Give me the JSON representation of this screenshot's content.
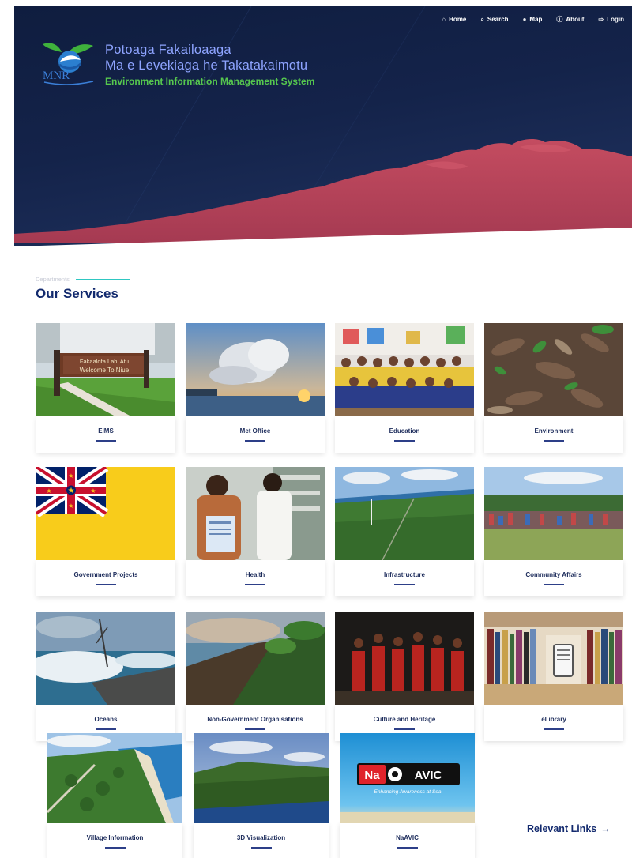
{
  "nav": {
    "items": [
      {
        "icon": "home-icon",
        "glyph": "⌂",
        "label": "Home",
        "active": true
      },
      {
        "icon": "search-icon",
        "glyph": "⌕",
        "label": "Search"
      },
      {
        "icon": "map-icon",
        "glyph": "●",
        "label": "Map"
      },
      {
        "icon": "info-icon",
        "glyph": "ⓘ",
        "label": "About"
      },
      {
        "icon": "login-icon",
        "glyph": "⇨",
        "label": "Login"
      }
    ]
  },
  "brand": {
    "logo_text": "MNR",
    "line1": "Potoaga Fakailoaaga",
    "line2": "Ma e Levekiaga he Takatakaimotu",
    "line3": "Environment Information Management System"
  },
  "services": {
    "eyebrow": "Departments",
    "title": "Our Services",
    "cards": [
      {
        "label": "EIMS",
        "sign1": "Fakaalofa Lahi Atu",
        "sign2": "Welcome To Niue"
      },
      {
        "label": "Met Office"
      },
      {
        "label": "Education"
      },
      {
        "label": "Environment"
      },
      {
        "label": "Government Projects"
      },
      {
        "label": "Health"
      },
      {
        "label": "Infrastructure"
      },
      {
        "label": "Community Affairs"
      },
      {
        "label": "Oceans"
      },
      {
        "label": "Non-Government Organisations"
      },
      {
        "label": "Culture and Heritage"
      },
      {
        "label": "eLibrary"
      },
      {
        "label": "Village Information"
      },
      {
        "label": "3D Visualization"
      },
      {
        "label": "NaAVIC",
        "logo_left": "Na",
        "logo_right": "AVIC",
        "tagline": "Enhancing Awareness at Sea"
      }
    ]
  },
  "relevant_links": {
    "label": "Relevant Links",
    "arrow": "→"
  },
  "colors": {
    "navy": "#132a6e",
    "accent_teal": "#2fc7c2",
    "brand_blue": "#8ea4ff",
    "brand_green": "#56c84e",
    "hero_red": "#b2445a"
  }
}
